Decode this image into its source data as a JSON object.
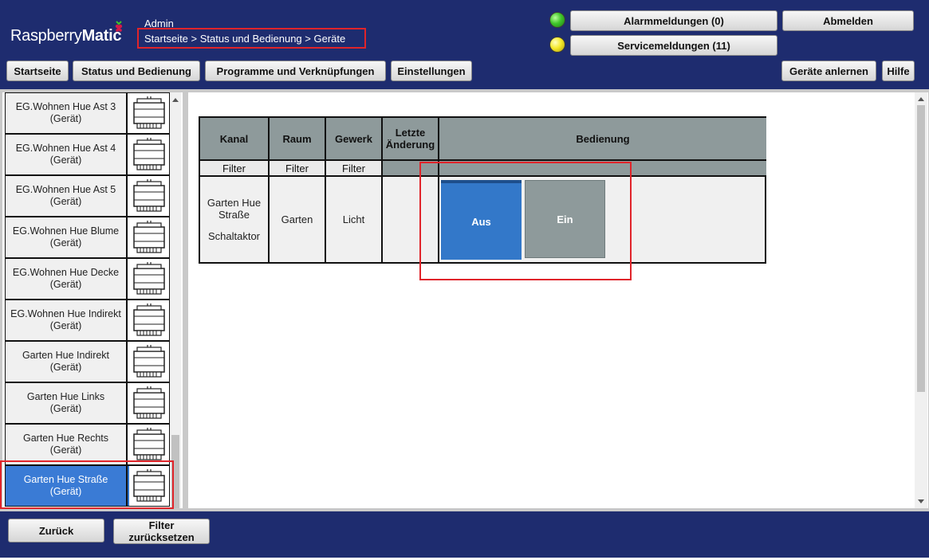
{
  "header": {
    "logo_text_a": "Raspberry",
    "logo_text_b": "Matic",
    "user": "Admin",
    "breadcrumb": "Startseite > Status und Bedienung > Geräte",
    "alarm_label": "Alarmmeldungen (0)",
    "service_label": "Servicemeldungen (11)",
    "logout_label": "Abmelden",
    "alarm_led_color": "#3fc52a",
    "service_led_color": "#f5e92a"
  },
  "nav": {
    "start": "Startseite",
    "status": "Status und Bedienung",
    "programs": "Programme und Verknüpfungen",
    "settings": "Einstellungen",
    "learn": "Geräte anlernen",
    "help": "Hilfe"
  },
  "sidebar": {
    "items": [
      {
        "name": "EG.Wohnen Hue Ast 3",
        "type": "(Gerät)",
        "icon": "switch-actuator-icon"
      },
      {
        "name": "EG.Wohnen Hue Ast 4",
        "type": "(Gerät)",
        "icon": "switch-actuator-icon"
      },
      {
        "name": "EG.Wohnen Hue Ast 5",
        "type": "(Gerät)",
        "icon": "switch-actuator-icon"
      },
      {
        "name": "EG.Wohnen Hue Blume",
        "type": "(Gerät)",
        "icon": "switch-actuator-icon"
      },
      {
        "name": "EG.Wohnen Hue Decke",
        "type": "(Gerät)",
        "icon": "switch-actuator-icon"
      },
      {
        "name": "EG.Wohnen Hue Indirekt",
        "type": "(Gerät)",
        "icon": "switch-actuator-icon"
      },
      {
        "name": "Garten Hue Indirekt",
        "type": "(Gerät)",
        "icon": "switch-actuator-icon"
      },
      {
        "name": "Garten Hue Links",
        "type": "(Gerät)",
        "icon": "switch-actuator-icon"
      },
      {
        "name": "Garten Hue Rechts",
        "type": "(Gerät)",
        "icon": "switch-actuator-icon"
      },
      {
        "name": "Garten Hue Straße",
        "type": "(Gerät)",
        "icon": "switch-actuator-icon",
        "selected": true
      }
    ],
    "selected_color": "#3a7bd5"
  },
  "table": {
    "headers": {
      "channel": "Kanal",
      "room": "Raum",
      "trade": "Gewerk",
      "last_change": "Letzte Änderung",
      "control": "Bedienung"
    },
    "filter_label": "Filter",
    "row": {
      "channel_name": "Garten Hue Straße",
      "channel_type": "Schaltaktor",
      "room": "Garten",
      "trade": "Licht",
      "last_change": ""
    },
    "controls": {
      "off_label": "Aus",
      "on_label": "Ein",
      "off_color": "#3378c9",
      "on_color": "#8e9a9b",
      "state": "off"
    }
  },
  "footer": {
    "back_label": "Zurück",
    "reset_line1": "Filter",
    "reset_line2": "zurücksetzen"
  },
  "colors": {
    "header_bg": "#1e2c6f",
    "highlight": "#e0242a"
  }
}
